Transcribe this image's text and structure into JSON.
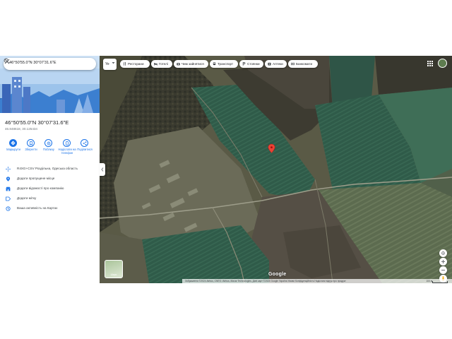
{
  "search": {
    "value": "46°50'55.0\"N 30°07'31.6\"E"
  },
  "place": {
    "title": "46°50'55.0\"N 30°07'31.6\"E",
    "decimal": "46.848618, 30.125434"
  },
  "actions": [
    {
      "label": "Маршрути",
      "icon": "directions-icon"
    },
    {
      "label": "Зберегти",
      "icon": "bookmark-icon"
    },
    {
      "label": "Поблизу",
      "icon": "nearby-icon"
    },
    {
      "label": "Надіслати на телефон",
      "icon": "phone-icon"
    },
    {
      "label": "Поділитися",
      "icon": "share-icon"
    }
  ],
  "info": [
    {
      "text": "R4XG+CSV Роздільна, Одеська область",
      "icon": "plus-code-icon"
    },
    {
      "text": "Додати пропущене місце",
      "icon": "add-place-icon"
    },
    {
      "text": "Додати відомості про компанію",
      "icon": "business-icon"
    },
    {
      "text": "Додати мітку",
      "icon": "label-icon"
    },
    {
      "text": "Ваша активність на Картах",
      "icon": "history-icon"
    }
  ],
  "lang": {
    "value": "Ye"
  },
  "chips": [
    {
      "label": "Ресторани",
      "icon": "restaurant-icon"
    },
    {
      "label": "Готелі",
      "icon": "hotel-icon"
    },
    {
      "label": "Чим зайнятися",
      "icon": "camera-icon"
    },
    {
      "label": "Транспорт",
      "icon": "transit-icon"
    },
    {
      "label": "Стоянки",
      "icon": "parking-icon"
    },
    {
      "label": "Аптеки",
      "icon": "pharmacy-icon"
    },
    {
      "label": "Банкомати",
      "icon": "atm-icon"
    }
  ],
  "layers": {
    "label": "Шари"
  },
  "map": {
    "attribution": "Зображення ©2024 Airbus, CNES / Airbus, Maxar Technologies, Дані карт ©2024 Google   Україна   Умови   Конфіденційність   Надіслати відгук про продукт",
    "scale": "100 м",
    "logo": "Google"
  },
  "colors": {
    "accent": "#1a73e8",
    "pin": "#ea4335"
  }
}
